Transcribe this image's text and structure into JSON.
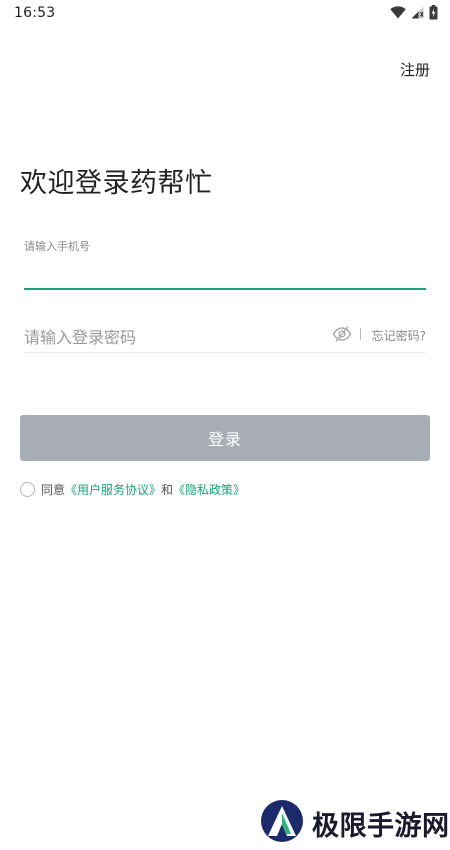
{
  "status_bar": {
    "time": "16:53",
    "icons": [
      "wifi-icon",
      "cell-signal-icon",
      "battery-icon"
    ]
  },
  "header": {
    "register_label": "注册"
  },
  "title": "欢迎登录药帮忙",
  "phone_field": {
    "label": "请输入手机号",
    "value": ""
  },
  "password_field": {
    "placeholder": "请输入登录密码",
    "value": "",
    "visibility_icon": "eye-off-icon",
    "forgot_label": "忘记密码?"
  },
  "login_button": {
    "label": "登录"
  },
  "agreement": {
    "checked": false,
    "prefix": "同意",
    "user_agreement": "《用户服务协议》",
    "conjunction": "和",
    "privacy_policy": "《隐私政策》"
  },
  "colors": {
    "accent": "#1aa27a",
    "button_disabled": "#a8acb4",
    "text_primary": "#222222",
    "text_secondary": "#888888"
  },
  "watermark": {
    "text": "极限手游网",
    "logo": "watermark-logo"
  }
}
